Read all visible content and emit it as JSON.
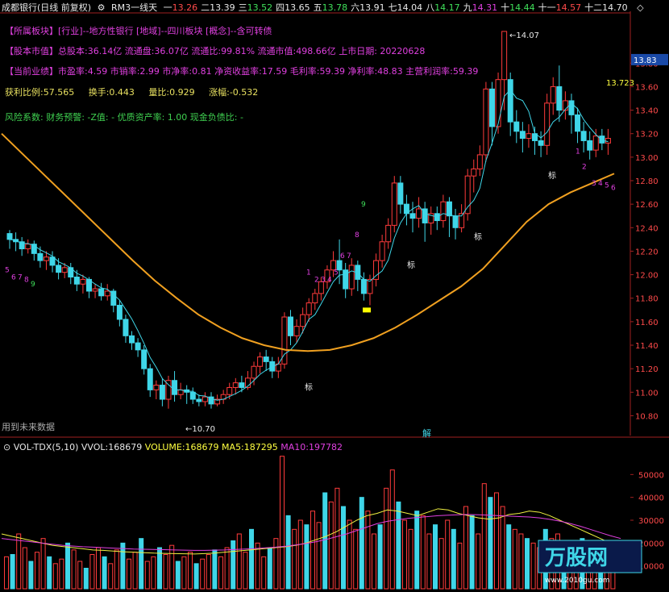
{
  "header": {
    "title": "成都银行(日线 前复权)",
    "indicator": "RM3一线天",
    "values": [
      {
        "label": "一",
        "value": "13.26",
        "color": "red"
      },
      {
        "label": "二",
        "value": "13.39",
        "color": "white"
      },
      {
        "label": "三",
        "value": "13.52",
        "color": "green"
      },
      {
        "label": "四",
        "value": "13.65",
        "color": "white"
      },
      {
        "label": "五",
        "value": "13.78",
        "color": "green"
      },
      {
        "label": "六",
        "value": "13.91",
        "color": "white"
      },
      {
        "label": "七",
        "value": "14.04",
        "color": "white"
      },
      {
        "label": "八",
        "value": "14.17",
        "color": "green"
      },
      {
        "label": "九",
        "value": "14.31",
        "color": "mag"
      },
      {
        "label": "十",
        "value": "14.44",
        "color": "green"
      },
      {
        "label": "十一",
        "value": "14.57",
        "color": "red"
      },
      {
        "label": "十二",
        "value": "14.70",
        "color": "white"
      }
    ]
  },
  "info": {
    "sector": "【所属板块】[行业]--地方性银行 [地域]--四川板块 [概念]--含可转债",
    "capital": "【股本市值】总股本:36.14亿 流通盘:36.07亿 流通比:99.81% 流通市值:498.66亿 上市日期: 20220628",
    "performance": "【当前业绩】市盈率:4.59 市销率:2.99 市净率:0.81 净资收益率:17.59 毛利率:59.39 净利率:48.83 主营利润率:59.39",
    "stats": [
      {
        "label": "获利比例:",
        "value": "57.565"
      },
      {
        "label": "换手:",
        "value": "0.443"
      },
      {
        "label": "量比:",
        "value": "0.929"
      },
      {
        "label": "涨幅:",
        "value": "-0.532"
      }
    ],
    "risk": "风险系数: 财务预警: -Z值: - 优质资产率: 1.00 现金负债比: -"
  },
  "future_note": "用到未来数据",
  "jie_label": "解",
  "biao_label": "标",
  "watermark": "万股网",
  "watermark_url": "www.2010gu.com",
  "colors": {
    "up": "#ff3b3b",
    "down": "#3fd6e8",
    "ma_long": "#f0a020",
    "ma_short": "#3fd6e8",
    "vol_ma5": "#f0f040",
    "vol_ma10": "#e040e0"
  },
  "chart_data": [
    {
      "type": "candlestick",
      "title": "成都银行(日线 前复权)",
      "ylim": [
        10.7,
        14.2
      ],
      "y_ticks": [
        "13.80",
        "13.60",
        "13.40",
        "13.20",
        "13.00",
        "12.80",
        "12.60",
        "12.40",
        "12.20",
        "12.00",
        "11.80",
        "11.60",
        "11.40",
        "11.20",
        "11.00",
        "10.80"
      ],
      "current_price": "13.83",
      "annotations": [
        {
          "text": "14.07",
          "kind": "high"
        },
        {
          "text": "10.70",
          "kind": "low"
        },
        {
          "text": "13.723",
          "kind": "ma"
        }
      ],
      "candles": [
        [
          12.35,
          12.3,
          12.38,
          12.22
        ],
        [
          12.3,
          12.28,
          12.36,
          12.2
        ],
        [
          12.28,
          12.22,
          12.32,
          12.16
        ],
        [
          12.22,
          12.26,
          12.3,
          12.18
        ],
        [
          12.26,
          12.18,
          12.29,
          12.12
        ],
        [
          12.18,
          12.12,
          12.24,
          12.06
        ],
        [
          12.12,
          12.15,
          12.2,
          12.04
        ],
        [
          12.15,
          12.08,
          12.2,
          12.02
        ],
        [
          12.08,
          12.02,
          12.14,
          11.96
        ],
        [
          12.02,
          12.06,
          12.1,
          11.97
        ],
        [
          12.06,
          11.98,
          12.1,
          11.92
        ],
        [
          11.98,
          11.92,
          12.04,
          11.86
        ],
        [
          11.92,
          11.96,
          12.0,
          11.84
        ],
        [
          11.96,
          11.86,
          11.98,
          11.8
        ],
        [
          11.86,
          11.88,
          11.92,
          11.8
        ],
        [
          11.88,
          11.82,
          11.93,
          11.78
        ],
        [
          11.82,
          11.86,
          11.92,
          11.78
        ],
        [
          11.86,
          11.74,
          11.88,
          11.68
        ],
        [
          11.74,
          11.62,
          11.78,
          11.56
        ],
        [
          11.62,
          11.48,
          11.66,
          11.42
        ],
        [
          11.48,
          11.42,
          11.52,
          11.36
        ],
        [
          11.42,
          11.36,
          11.46,
          11.3
        ],
        [
          11.36,
          11.2,
          11.4,
          11.15
        ],
        [
          11.2,
          11.02,
          11.24,
          10.96
        ],
        [
          11.02,
          11.06,
          11.1,
          10.94
        ],
        [
          11.06,
          10.94,
          11.12,
          10.88
        ],
        [
          10.94,
          11.1,
          11.14,
          10.86
        ],
        [
          11.1,
          10.98,
          11.18,
          10.92
        ],
        [
          10.98,
          11.02,
          11.08,
          10.94
        ],
        [
          11.02,
          11.0,
          11.06,
          10.9
        ],
        [
          11.0,
          10.94,
          11.04,
          10.9
        ],
        [
          10.94,
          10.92,
          10.98,
          10.88
        ],
        [
          10.92,
          10.96,
          11.0,
          10.88
        ],
        [
          10.96,
          10.9,
          11.0,
          10.86
        ],
        [
          10.9,
          10.94,
          10.98,
          10.88
        ],
        [
          10.94,
          10.98,
          11.02,
          10.9
        ],
        [
          10.98,
          11.04,
          11.08,
          10.94
        ],
        [
          11.04,
          11.08,
          11.12,
          10.98
        ],
        [
          11.08,
          11.04,
          11.14,
          11.0
        ],
        [
          11.04,
          11.12,
          11.18,
          11.02
        ],
        [
          11.12,
          11.22,
          11.26,
          11.06
        ],
        [
          11.22,
          11.3,
          11.34,
          11.16
        ],
        [
          11.3,
          11.26,
          11.36,
          11.18
        ],
        [
          11.26,
          11.18,
          11.3,
          11.12
        ],
        [
          11.18,
          11.24,
          11.3,
          11.12
        ],
        [
          11.24,
          11.64,
          11.68,
          11.2
        ],
        [
          11.64,
          11.48,
          11.7,
          11.4
        ],
        [
          11.48,
          11.56,
          11.62,
          11.42
        ],
        [
          11.56,
          11.66,
          11.72,
          11.5
        ],
        [
          11.66,
          11.76,
          11.8,
          11.6
        ],
        [
          11.76,
          11.84,
          11.88,
          11.7
        ],
        [
          11.84,
          11.94,
          11.98,
          11.78
        ],
        [
          11.94,
          12.04,
          12.08,
          11.88
        ],
        [
          12.04,
          12.12,
          12.2,
          11.98
        ],
        [
          12.12,
          12.04,
          12.3,
          11.92
        ],
        [
          12.04,
          11.88,
          12.1,
          11.8
        ],
        [
          11.88,
          12.08,
          12.14,
          11.82
        ],
        [
          12.08,
          11.96,
          12.12,
          11.86
        ],
        [
          11.96,
          11.84,
          12.02,
          11.78
        ],
        [
          11.84,
          11.96,
          12.0,
          11.74
        ],
        [
          11.96,
          12.12,
          12.18,
          11.9
        ],
        [
          12.12,
          12.28,
          12.34,
          12.06
        ],
        [
          12.28,
          12.42,
          12.48,
          12.22
        ],
        [
          12.42,
          12.78,
          12.84,
          12.36
        ],
        [
          12.78,
          12.6,
          12.84,
          12.52
        ],
        [
          12.6,
          12.52,
          12.68,
          12.42
        ],
        [
          12.52,
          12.48,
          12.62,
          12.36
        ],
        [
          12.48,
          12.56,
          12.66,
          12.4
        ],
        [
          12.56,
          12.44,
          12.62,
          12.28
        ],
        [
          12.44,
          12.52,
          12.58,
          12.34
        ],
        [
          12.52,
          12.46,
          12.58,
          12.38
        ],
        [
          12.46,
          12.62,
          12.68,
          12.4
        ],
        [
          12.62,
          12.5,
          12.66,
          12.32
        ],
        [
          12.5,
          12.4,
          12.56,
          12.3
        ],
        [
          12.4,
          12.52,
          12.6,
          12.36
        ],
        [
          12.52,
          12.84,
          12.9,
          12.46
        ],
        [
          12.84,
          12.9,
          12.98,
          12.7
        ],
        [
          12.9,
          13.02,
          13.1,
          12.84
        ],
        [
          13.02,
          13.58,
          13.64,
          12.96
        ],
        [
          13.58,
          13.26,
          13.64,
          13.1
        ],
        [
          13.26,
          13.66,
          13.72,
          13.2
        ],
        [
          13.66,
          14.07,
          14.07,
          13.4
        ],
        [
          13.66,
          13.3,
          13.72,
          13.18
        ],
        [
          13.3,
          13.22,
          13.4,
          13.12
        ],
        [
          13.22,
          13.16,
          13.3,
          13.04
        ],
        [
          13.16,
          13.2,
          13.28,
          13.08
        ],
        [
          13.2,
          13.14,
          13.26,
          13.02
        ],
        [
          13.14,
          13.1,
          13.22,
          13.0
        ],
        [
          13.1,
          13.46,
          13.54,
          13.02
        ],
        [
          13.46,
          13.6,
          13.68,
          13.36
        ],
        [
          13.6,
          13.4,
          13.78,
          13.3
        ],
        [
          13.4,
          13.48,
          13.56,
          13.32
        ],
        [
          13.48,
          13.36,
          13.54,
          13.2
        ],
        [
          13.36,
          13.22,
          13.42,
          13.12
        ],
        [
          13.22,
          13.14,
          13.3,
          13.04
        ],
        [
          13.14,
          13.06,
          13.22,
          12.98
        ],
        [
          13.06,
          13.18,
          13.24,
          13.0
        ],
        [
          13.18,
          13.12,
          13.24,
          13.06
        ],
        [
          13.12,
          13.16,
          13.24,
          13.02
        ]
      ],
      "ma_long": [
        13.2,
        13.02,
        12.84,
        12.66,
        12.48,
        12.3,
        12.12,
        11.95,
        11.8,
        11.66,
        11.55,
        11.46,
        11.4,
        11.36,
        11.35,
        11.36,
        11.4,
        11.46,
        11.55,
        11.66,
        11.78,
        11.9,
        12.05,
        12.25,
        12.45,
        12.6,
        12.7,
        12.78,
        12.86
      ],
      "signals": [
        {
          "text": "5",
          "color": "mag"
        },
        {
          "text": "6",
          "color": "mag"
        },
        {
          "text": "7",
          "color": "mag"
        },
        {
          "text": "8",
          "color": "mag"
        },
        {
          "text": "9",
          "color": "green"
        },
        {
          "text": "1",
          "color": "mag"
        },
        {
          "text": "2",
          "color": "mag"
        },
        {
          "text": "3",
          "color": "mag"
        },
        {
          "text": "4",
          "color": "mag"
        },
        {
          "text": "5",
          "color": "mag"
        },
        {
          "text": "6",
          "color": "mag"
        },
        {
          "text": "7",
          "color": "mag"
        },
        {
          "text": "8",
          "color": "mag"
        },
        {
          "text": "9",
          "color": "green"
        },
        {
          "text": "1",
          "color": "mag"
        },
        {
          "text": "2",
          "color": "mag"
        },
        {
          "text": "3",
          "color": "mag"
        },
        {
          "text": "4",
          "color": "mag"
        },
        {
          "text": "5",
          "color": "mag"
        },
        {
          "text": "6",
          "color": "mag"
        }
      ]
    },
    {
      "type": "bar",
      "title": "VOL-TDX(5,10)",
      "legend": [
        {
          "label": "VVOL:",
          "value": "168679",
          "color": "white"
        },
        {
          "label": "VOLUME:",
          "value": "168679",
          "color": "yel"
        },
        {
          "label": "MA5:",
          "value": "187295",
          "color": "yel"
        },
        {
          "label": "MA10:",
          "value": "197782",
          "color": "mag"
        }
      ],
      "ylim": [
        0,
        60000
      ],
      "y_ticks": [
        "50000",
        "40000",
        "30000",
        "20000",
        "10000"
      ],
      "volumes": [
        14000,
        15000,
        24000,
        18000,
        12000,
        16000,
        22000,
        14000,
        11000,
        13000,
        20000,
        17000,
        12000,
        9000,
        15000,
        18000,
        14000,
        11000,
        17000,
        20000,
        13000,
        16000,
        22000,
        12000,
        14000,
        18000,
        15000,
        19000,
        12000,
        14000,
        16000,
        11000,
        13000,
        15000,
        17000,
        14000,
        18000,
        21000,
        24000,
        16000,
        26000,
        20000,
        14000,
        18000,
        22000,
        58000,
        32000,
        26000,
        30000,
        28000,
        34000,
        29000,
        42000,
        38000,
        44000,
        36000,
        30000,
        26000,
        40000,
        34000,
        24000,
        28000,
        44000,
        52000,
        38000,
        30000,
        26000,
        34000,
        32000,
        24000,
        28000,
        22000,
        30000,
        26000,
        20000,
        36000,
        32000,
        24000,
        46000,
        40000,
        42000,
        36000,
        28000,
        26000,
        24000,
        22000,
        20000,
        18000,
        26000,
        22000,
        24000,
        20000,
        18000,
        16000,
        22000,
        20000,
        18000,
        16000,
        14000,
        12000
      ],
      "ma5": [
        24000,
        23000,
        22000,
        21000,
        20000,
        19000,
        18500,
        18000,
        17500,
        17000,
        16800,
        16500,
        16200,
        16000,
        15800,
        15600,
        15500,
        15400,
        15300,
        15200,
        15400,
        15600,
        16000,
        16400,
        16800,
        17200,
        17600,
        18000,
        18400,
        19000,
        20000,
        21500,
        23000,
        25000,
        27500,
        30000,
        32000,
        33000,
        34500,
        34000,
        33000,
        32000,
        33500,
        35000,
        34500,
        33000,
        32000,
        31000,
        30500,
        31000,
        32500,
        33000,
        34000,
        33500,
        32000,
        30000,
        28000,
        26000,
        24000,
        22000,
        20000,
        18500
      ],
      "ma10": [
        22000,
        21500,
        21000,
        20500,
        20000,
        19500,
        19000,
        18700,
        18400,
        18200,
        18000,
        17800,
        17600,
        17400,
        17300,
        17200,
        17100,
        17000,
        16900,
        16800,
        16800,
        16900,
        17000,
        17200,
        17400,
        17600,
        17900,
        18200,
        18600,
        19200,
        19800,
        20600,
        21600,
        22800,
        24000,
        25500,
        27000,
        28500,
        29500,
        30200,
        30800,
        31200,
        31600,
        32000,
        32200,
        32400,
        32500,
        32400,
        32200,
        32000,
        31800,
        31600,
        31400,
        31000,
        30400,
        29600,
        28600,
        27400,
        26000,
        24600,
        23200,
        22000
      ]
    }
  ]
}
